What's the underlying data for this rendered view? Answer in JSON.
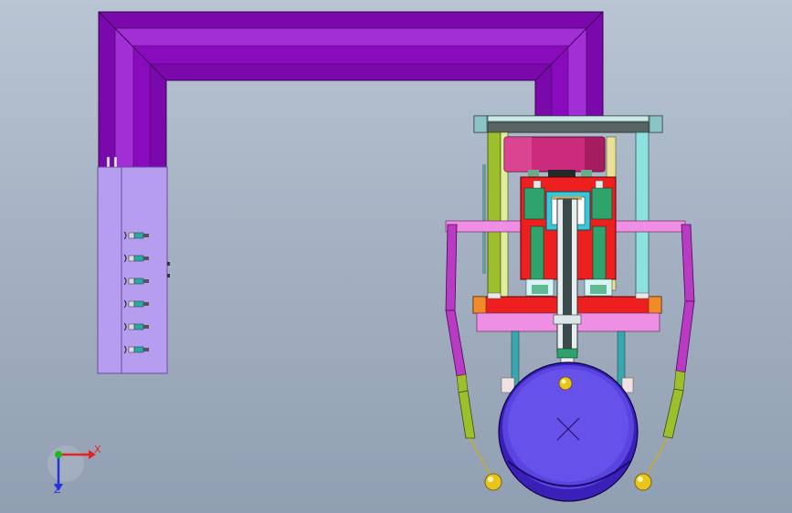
{
  "viewport": {
    "background_top": "#b9c5d3",
    "background_bottom": "#919fb2"
  },
  "colors": {
    "frame_purple": "#8a0bbd",
    "frame_purple_light": "#b33ee0",
    "cabinet_lavender": "#b79df0",
    "platform_pink": "#ee8fe4",
    "cylinder_red": "#ee1f1f",
    "drum_magenta": "#cc2a7c",
    "guide_rod_green": "#2ea36b",
    "carriage_cyan": "#39c6d6",
    "strut_olive": "#9dbf2c",
    "chain_magenta": "#b93ac3",
    "wheel_blue": "#3a1fb8",
    "ball_yellow": "#e9c41a",
    "axis_x_red": "#e52222",
    "axis_y_green": "#1fb81f",
    "axis_z_blue": "#2233dd"
  },
  "axes": {
    "x_label": "X",
    "z_label": "Z",
    "x_color": "#e52222",
    "z_color": "#2233dd"
  },
  "cabinet": {
    "connector_count": 6
  }
}
